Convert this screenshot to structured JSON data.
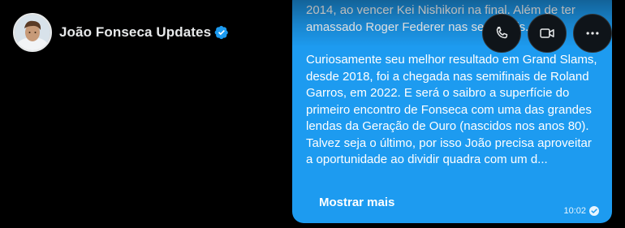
{
  "header": {
    "name": "João Fonseca Updates",
    "avatar_icon": "avatar-photo",
    "verified_icon": "verified-badge-icon",
    "accent_color": "#1d9bf0"
  },
  "message": {
    "partial_line_1": "2014, ao vencer Kei Nishikori na final. Além de ter",
    "partial_line_2": "amassado Roger Federer nas semifinais.",
    "paragraph": "Curiosamente seu melhor resultado em Grand Slams, desde 2018, foi a chegada nas semifinais de Roland Garros, em 2022. E será o saibro a superfície do primeiro encontro de Fonseca com uma das grandes lendas da Geração de Ouro (nascidos nos anos 80). Talvez seja o último, por isso João precisa aproveitar a oportunidade ao dividir quadra com um d...",
    "show_more": "Mostrar mais",
    "time": "10:02",
    "bubble_color": "#1d9bf0"
  },
  "actions": {
    "call_icon": "phone-icon",
    "video_icon": "video-camera-icon",
    "more_icon": "more-horizontal-icon"
  }
}
